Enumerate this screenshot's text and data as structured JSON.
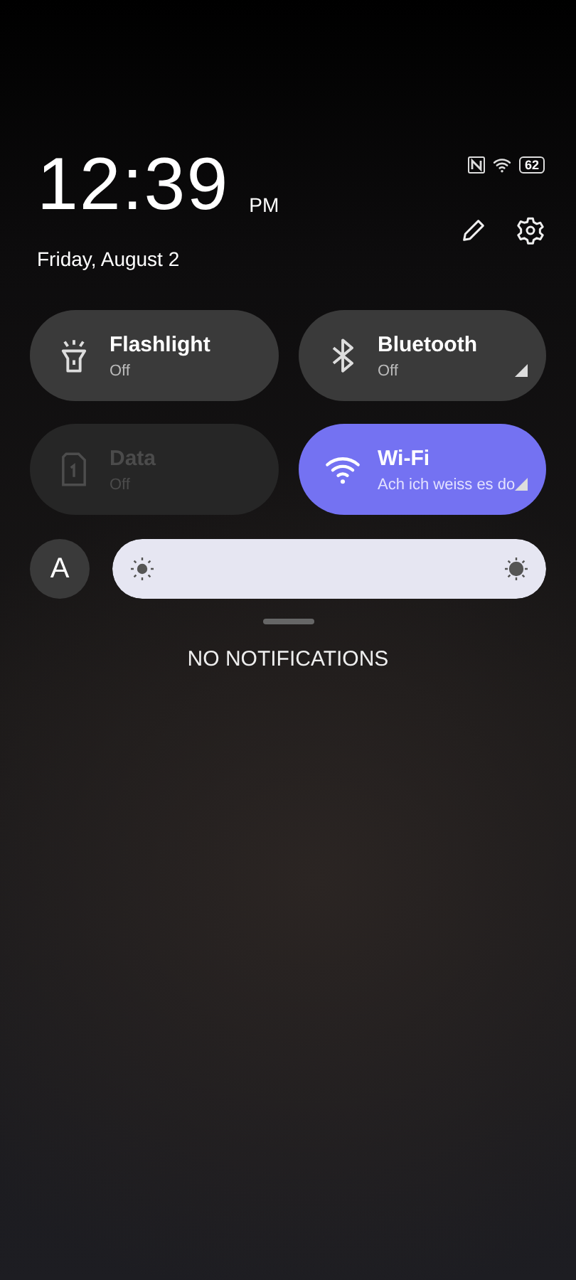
{
  "status_bar": {
    "battery": "62"
  },
  "clock": {
    "time": "12:39",
    "period": "PM",
    "date": "Friday, August 2"
  },
  "tiles": [
    {
      "kind": "flashlight",
      "label": "Flashlight",
      "status": "Off",
      "on": false,
      "disabled": false,
      "expandable": false
    },
    {
      "kind": "bluetooth",
      "label": "Bluetooth",
      "status": "Off",
      "on": false,
      "disabled": false,
      "expandable": true
    },
    {
      "kind": "data",
      "label": "Data",
      "status": "Off",
      "on": false,
      "disabled": true,
      "expandable": false
    },
    {
      "kind": "wifi",
      "label": "Wi-Fi",
      "status": "Ach ich weiss es do",
      "on": true,
      "disabled": false,
      "expandable": true
    }
  ],
  "brightness": {
    "auto_label": "A",
    "level": 1
  },
  "notifications": {
    "empty_text": "NO NOTIFICATIONS"
  }
}
